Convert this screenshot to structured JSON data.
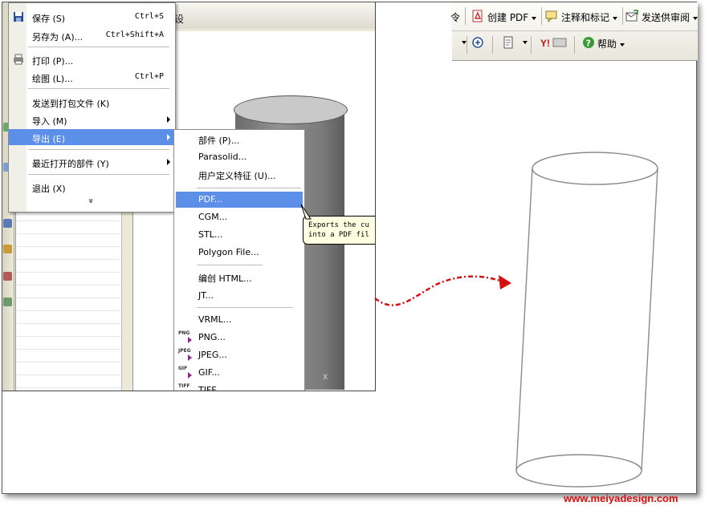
{
  "window": {
    "title_fragment": "设"
  },
  "file_menu": {
    "items": [
      {
        "label": "保存 (S)",
        "shortcut": "Ctrl+S",
        "icon": "save-icon"
      },
      {
        "label": "另存为 (A)...",
        "shortcut": "Ctrl+Shift+A"
      },
      {
        "label": "打印 (P)...",
        "icon": "print-icon"
      },
      {
        "label": "绘图 (L)...",
        "shortcut": "Ctrl+P"
      },
      {
        "label": "发送到打包文件 (K)"
      },
      {
        "label": "导入 (M)",
        "submenu": true
      },
      {
        "label": "导出 (E)",
        "submenu": true,
        "highlighted": true
      },
      {
        "label": "最近打开的部件 (Y)",
        "submenu": true
      },
      {
        "label": "退出 (X)"
      }
    ],
    "more_glyph": "»"
  },
  "export_submenu": {
    "items": [
      {
        "label": "部件 (P)..."
      },
      {
        "label": "Parasolid..."
      },
      {
        "label": "用户定义特征 (U)..."
      },
      {
        "label": "PDF...",
        "highlighted": true
      },
      {
        "label": "CGM..."
      },
      {
        "label": "STL..."
      },
      {
        "label": "Polygon File..."
      },
      {
        "label": "编创 HTML..."
      },
      {
        "label": "JT..."
      },
      {
        "label": "VRML..."
      },
      {
        "label": "PNG...",
        "badge": "PNG"
      },
      {
        "label": "JPEG...",
        "badge": "JPEG"
      },
      {
        "label": "GIF...",
        "badge": "GIF"
      },
      {
        "label": "TIFF...",
        "badge": "TIFF"
      }
    ]
  },
  "tooltip": {
    "line1": "Exports the cu",
    "line2": "into a PDF fil"
  },
  "viewport": {
    "axis_label": "X"
  },
  "acrobat_toolbar": {
    "row1": {
      "partial_label": "令",
      "create_pdf": "创建 PDF",
      "comment": "注释和标记",
      "send_review": "发送供审阅"
    },
    "row2": {
      "help": "帮助"
    }
  },
  "colors": {
    "menu_highlight": "#5b8fe8",
    "arrow": "#d61010",
    "watermark": "#d61010",
    "tooltip_bg": "#ffffe1"
  },
  "watermark": "www.meiyadesign.com"
}
